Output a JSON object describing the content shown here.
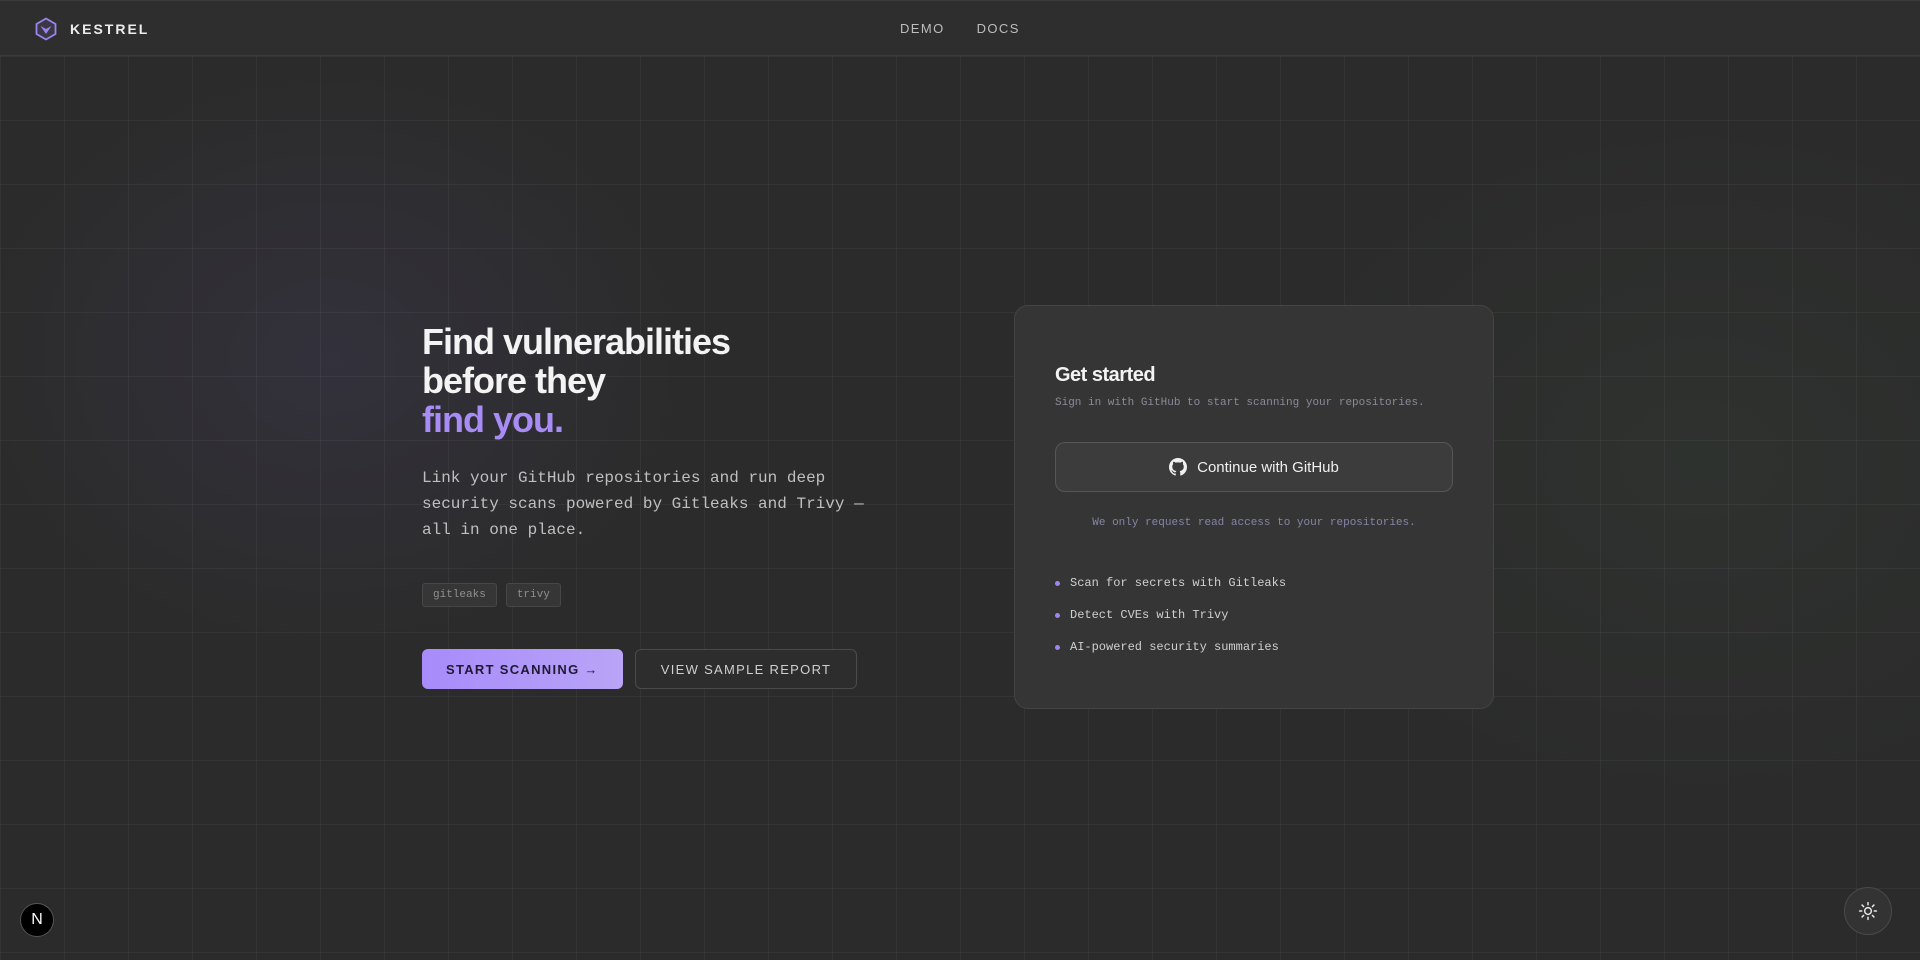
{
  "header": {
    "brand": "KESTREL",
    "nav": [
      {
        "label": "DEMO"
      },
      {
        "label": "DOCS"
      }
    ]
  },
  "hero": {
    "title_line1": "Find vulnerabilities",
    "title_line2": "before they",
    "title_accent": "find you.",
    "description": "Link your GitHub repositories and run deep security scans powered by Gitleaks and Trivy — all in one place.",
    "tags": [
      "gitleaks",
      "trivy"
    ],
    "primary_button": "START SCANNING →",
    "secondary_button": "VIEW SAMPLE REPORT"
  },
  "card": {
    "title": "Get started",
    "subtitle": "Sign in with GitHub to start scanning your repositories.",
    "github_button": "Continue with GitHub",
    "note": "We only request read access to your repositories.",
    "features": [
      "Scan for secrets with Gitleaks",
      "Detect CVEs with Trivy",
      "AI-powered security summaries"
    ]
  },
  "floating": {
    "next_badge": "N"
  },
  "colors": {
    "accent": "#a78bfa",
    "background": "#2b2b2b",
    "card": "#353535"
  },
  "icons": [
    "kestrel-logo-icon",
    "github-icon",
    "sun-icon"
  ]
}
